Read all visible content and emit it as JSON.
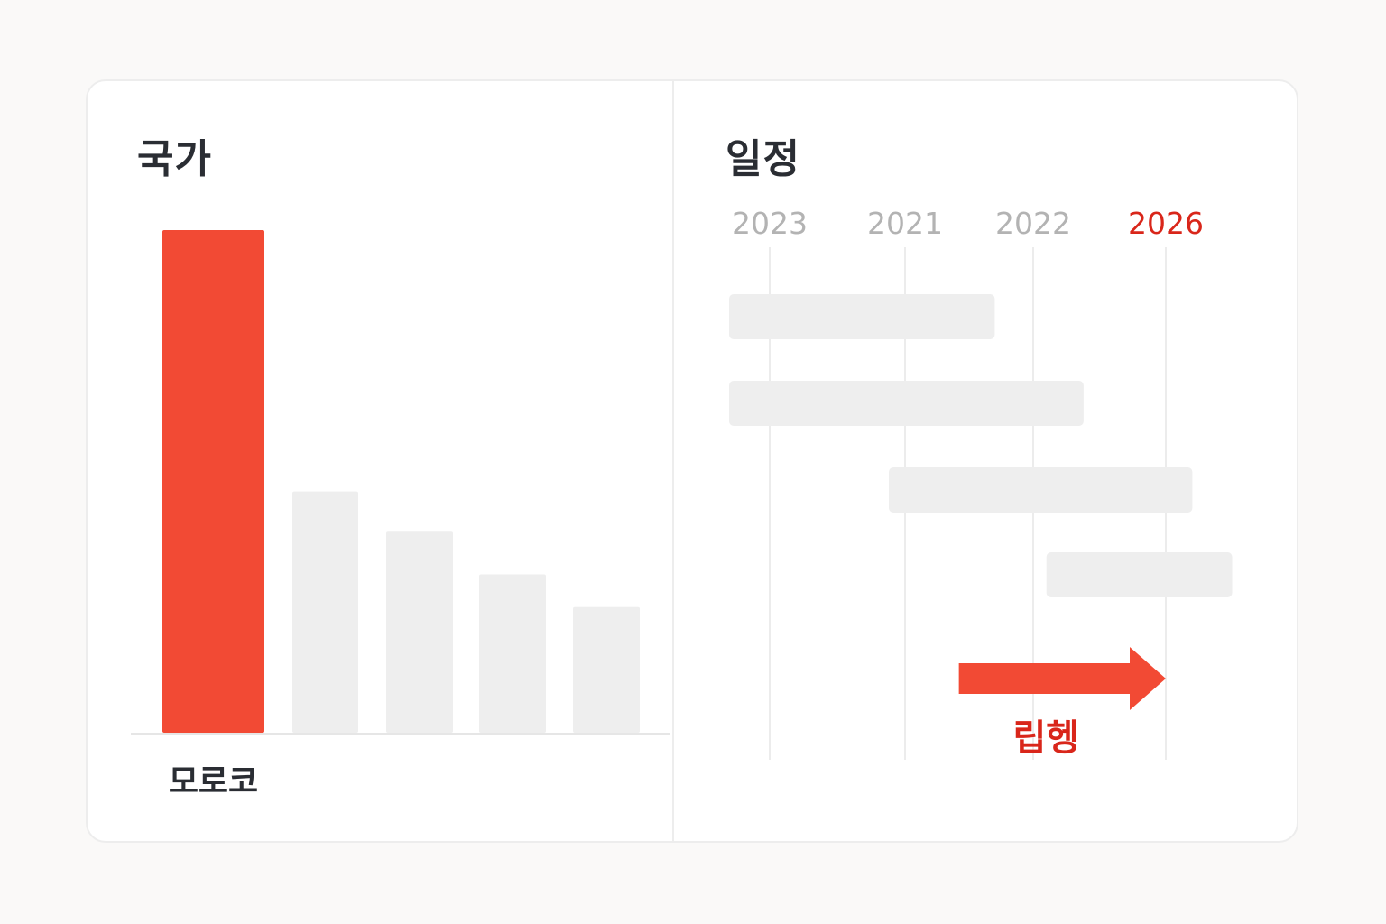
{
  "country_panel": {
    "title": "국가"
  },
  "schedule_panel": {
    "title": "일정"
  },
  "colors": {
    "highlight": "#f24a34",
    "muted_bar": "#eeeeee",
    "year_muted": "#b3b3b3",
    "year_highlight": "#d9261a",
    "title_text": "#2a2d33"
  },
  "chart_data": [
    {
      "type": "bar",
      "title": "국가",
      "categories": [
        "모로코",
        "",
        "",
        "",
        ""
      ],
      "values": [
        100,
        48,
        40,
        31.5,
        25
      ],
      "highlight_index": 0,
      "ylim": [
        0,
        100
      ],
      "grid": false
    },
    {
      "type": "gantt",
      "title": "일정",
      "axis_years": [
        "2023",
        "2021",
        "2022",
        "2026"
      ],
      "highlight_year_index": 3,
      "bars": [
        {
          "start": -0.3,
          "end": 1.7
        },
        {
          "start": -0.3,
          "end": 2.38
        },
        {
          "start": 0.88,
          "end": 3.2
        },
        {
          "start": 2.1,
          "end": 3.5
        }
      ],
      "arrow": {
        "start": 1.42,
        "end": 3.0,
        "label": "립헹"
      },
      "grid": true
    }
  ]
}
